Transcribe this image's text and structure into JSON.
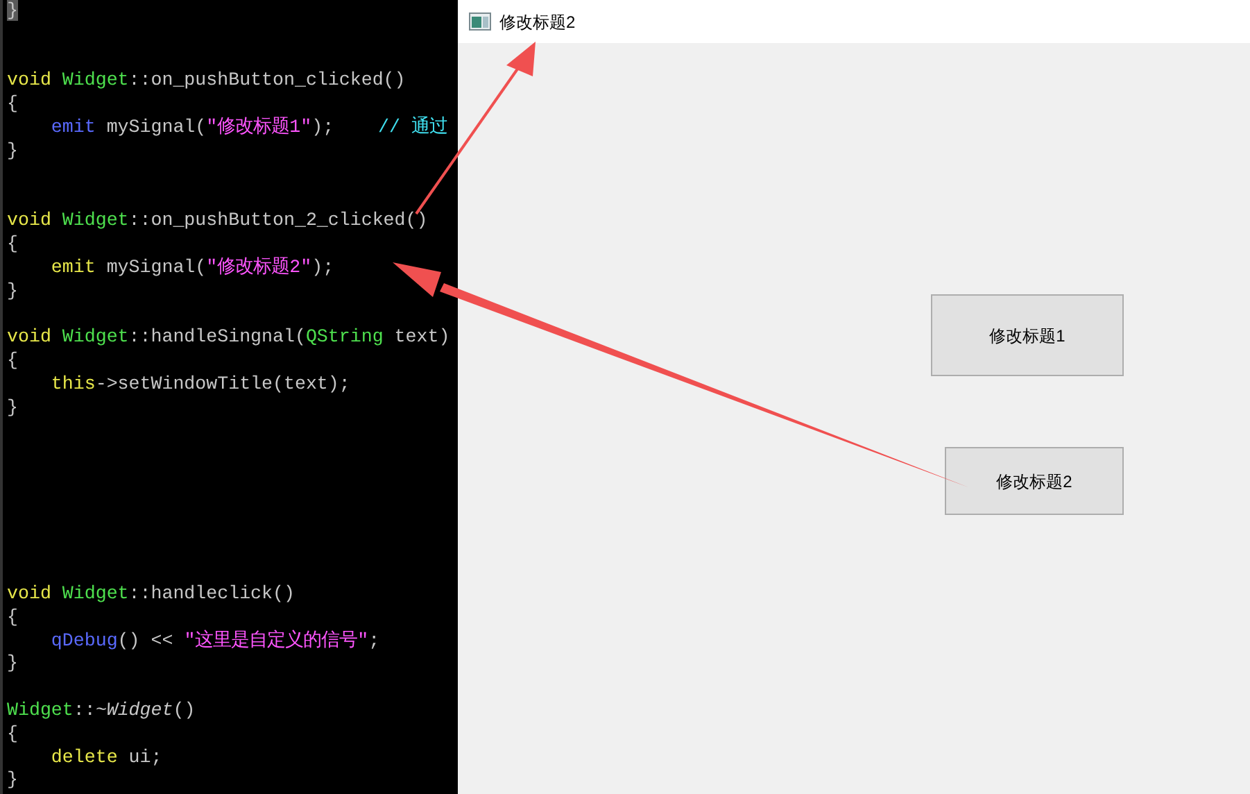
{
  "editor": {
    "lines": [
      {
        "kind": "code",
        "tokens": [
          {
            "t": "}",
            "kind": "match"
          }
        ]
      },
      {
        "kind": "blank"
      },
      {
        "kind": "blank"
      },
      {
        "kind": "code",
        "tokens": [
          {
            "t": "void",
            "kind": "keyword"
          },
          {
            "t": " Widget",
            "kind": "class"
          },
          {
            "t": "::on_pushButton_clicked()",
            "kind": "plain"
          }
        ]
      },
      {
        "kind": "code",
        "tokens": [
          {
            "t": "{",
            "kind": "plain"
          }
        ]
      },
      {
        "kind": "code",
        "tokens": [
          {
            "t": "    emit",
            "kind": "macro"
          },
          {
            "t": " mySignal(",
            "kind": "plain"
          },
          {
            "t": "\"修改标题1\"",
            "kind": "string"
          },
          {
            "t": ");    ",
            "kind": "plain"
          },
          {
            "t": "// 通过",
            "kind": "comment"
          }
        ]
      },
      {
        "kind": "code",
        "tokens": [
          {
            "t": "}",
            "kind": "plain"
          }
        ]
      },
      {
        "kind": "blank"
      },
      {
        "kind": "blank"
      },
      {
        "kind": "code",
        "tokens": [
          {
            "t": "void",
            "kind": "keyword"
          },
          {
            "t": " Widget",
            "kind": "class"
          },
          {
            "t": "::on_pushButton_2_clicked()",
            "kind": "plain"
          }
        ]
      },
      {
        "kind": "code",
        "tokens": [
          {
            "t": "{",
            "kind": "plain"
          }
        ]
      },
      {
        "kind": "code",
        "tokens": [
          {
            "t": "    emit",
            "kind": "keyword"
          },
          {
            "t": " mySignal(",
            "kind": "plain"
          },
          {
            "t": "\"修改标题2\"",
            "kind": "string"
          },
          {
            "t": ");",
            "kind": "plain"
          }
        ]
      },
      {
        "kind": "code",
        "tokens": [
          {
            "t": "}",
            "kind": "plain"
          }
        ]
      },
      {
        "kind": "blank"
      },
      {
        "kind": "code",
        "tokens": [
          {
            "t": "void",
            "kind": "keyword"
          },
          {
            "t": " Widget",
            "kind": "class"
          },
          {
            "t": "::handleSingnal(",
            "kind": "plain"
          },
          {
            "t": "QString",
            "kind": "class"
          },
          {
            "t": " text)",
            "kind": "plain"
          }
        ]
      },
      {
        "kind": "code",
        "tokens": [
          {
            "t": "{",
            "kind": "plain"
          }
        ]
      },
      {
        "kind": "code",
        "tokens": [
          {
            "t": "    this",
            "kind": "keyword"
          },
          {
            "t": "->setWindowTitle(text);",
            "kind": "plain"
          }
        ]
      },
      {
        "kind": "code",
        "tokens": [
          {
            "t": "}",
            "kind": "plain"
          }
        ]
      },
      {
        "kind": "blank"
      },
      {
        "kind": "blank"
      },
      {
        "kind": "blank"
      },
      {
        "kind": "blank"
      },
      {
        "kind": "blank"
      },
      {
        "kind": "blank"
      },
      {
        "kind": "blank"
      },
      {
        "kind": "code",
        "tokens": [
          {
            "t": "void",
            "kind": "keyword"
          },
          {
            "t": " Widget",
            "kind": "class"
          },
          {
            "t": "::handleclick()",
            "kind": "plain"
          }
        ]
      },
      {
        "kind": "code",
        "tokens": [
          {
            "t": "{",
            "kind": "plain"
          }
        ]
      },
      {
        "kind": "code",
        "tokens": [
          {
            "t": "    qDebug",
            "kind": "macro"
          },
          {
            "t": "() << ",
            "kind": "plain"
          },
          {
            "t": "\"这里是自定义的信号\"",
            "kind": "string"
          },
          {
            "t": ";",
            "kind": "plain"
          }
        ]
      },
      {
        "kind": "code",
        "tokens": [
          {
            "t": "}",
            "kind": "plain"
          }
        ]
      },
      {
        "kind": "blank"
      },
      {
        "kind": "code",
        "tokens": [
          {
            "t": "Widget",
            "kind": "class"
          },
          {
            "t": "::",
            "kind": "plain"
          },
          {
            "t": "~Widget",
            "kind": "italic"
          },
          {
            "t": "()",
            "kind": "plain"
          }
        ]
      },
      {
        "kind": "code",
        "tokens": [
          {
            "t": "{",
            "kind": "plain"
          }
        ]
      },
      {
        "kind": "code",
        "tokens": [
          {
            "t": "    delete",
            "kind": "keyword"
          },
          {
            "t": " ui;",
            "kind": "plain"
          }
        ]
      },
      {
        "kind": "code",
        "tokens": [
          {
            "t": "}",
            "kind": "plain"
          }
        ]
      }
    ]
  },
  "window": {
    "title": "修改标题2",
    "buttons": [
      {
        "label": "修改标题1"
      },
      {
        "label": "修改标题2"
      }
    ]
  }
}
